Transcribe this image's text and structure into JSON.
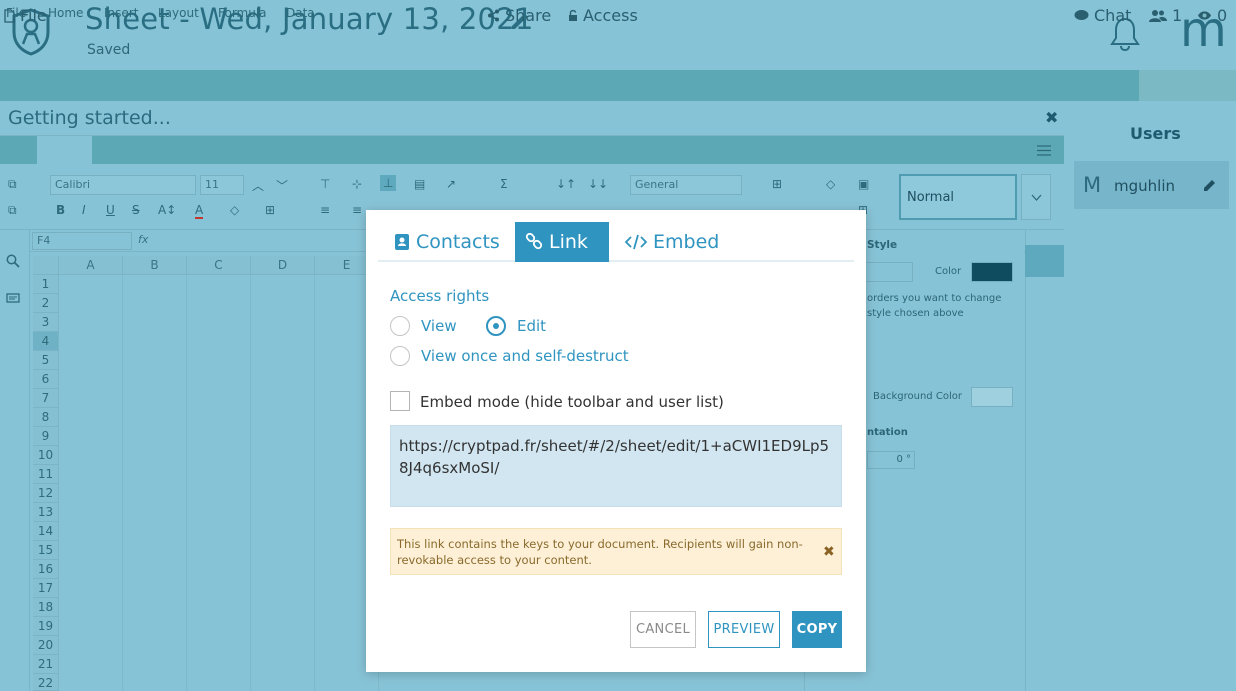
{
  "app": {
    "title": "Sheet - Wed, January 13, 2021",
    "status": "Saved",
    "user_initial": "m"
  },
  "toolbar": {
    "file": "File",
    "share": "Share",
    "access": "Access",
    "chat": "Chat",
    "users_count": "1",
    "viewers_count": "0"
  },
  "getting_started": {
    "title": "Getting started..."
  },
  "sheet_menu": {
    "items": [
      "File",
      "Home",
      "Insert",
      "Layout",
      "Formula",
      "Data"
    ]
  },
  "ribbon": {
    "font": "Calibri",
    "size": "11",
    "number_format": "General",
    "style": "Normal"
  },
  "formula_bar": {
    "cell_ref": "F4",
    "fx": "fx"
  },
  "grid": {
    "columns": [
      "A",
      "B",
      "C",
      "D",
      "E"
    ],
    "rows": [
      "1",
      "2",
      "3",
      "4",
      "5",
      "6",
      "7",
      "8",
      "9",
      "10",
      "11",
      "12",
      "13",
      "14",
      "15",
      "16",
      "17",
      "18",
      "19",
      "20",
      "21",
      "22"
    ]
  },
  "style_panel": {
    "style_label": "Style",
    "color_label": "Color",
    "borders_hint_1": "orders you want to change",
    "borders_hint_2": "style chosen above",
    "bg_color_label": "Background Color",
    "orientation_label": "ntation",
    "angle": "0 °"
  },
  "users_panel": {
    "title": "Users",
    "user_initial": "M",
    "user_name": "mguhlin"
  },
  "modal": {
    "tabs": [
      "Contacts",
      "Link",
      "Embed"
    ],
    "active_tab": "Link",
    "access_rights_label": "Access rights",
    "options": {
      "view": "View",
      "edit": "Edit",
      "view_once": "View once and self-destruct"
    },
    "selected": "edit",
    "embed_mode_label": "Embed mode (hide toolbar and user list)",
    "link": "https://cryptpad.fr/sheet/#/2/sheet/edit/1+aCWI1ED9Lp58J4q6sxMoSI/",
    "warning": "This link contains the keys to your document. Recipients will gain non-revokable access to your content.",
    "buttons": {
      "cancel": "CANCEL",
      "preview": "PREVIEW",
      "copy": "COPY"
    }
  },
  "colors": {
    "accent": "#2f94c0",
    "overlay": "#87c3d6",
    "toolbar": "#5ca8b4",
    "warning_bg": "#fdf0d6"
  }
}
